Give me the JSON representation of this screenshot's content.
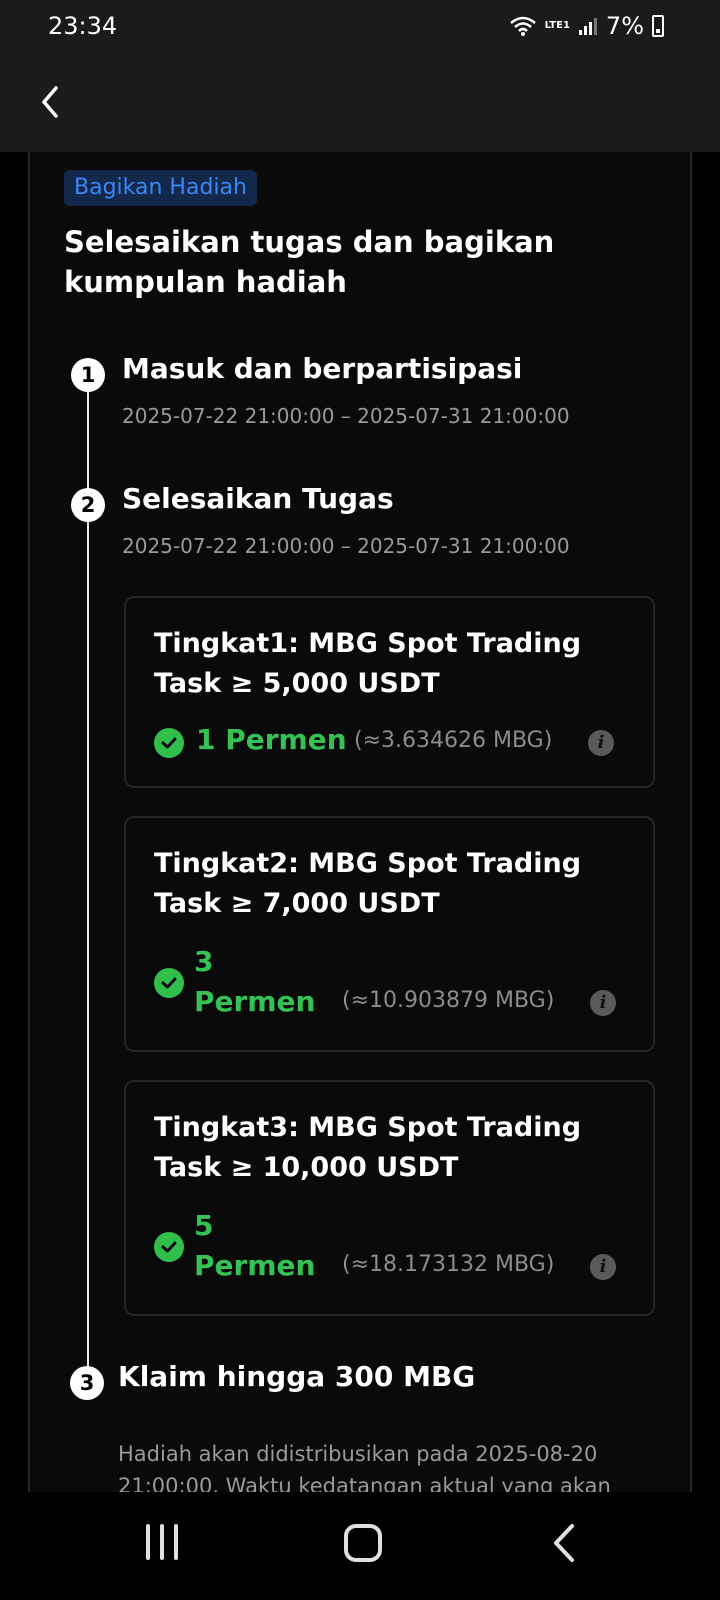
{
  "status_bar": {
    "time": "23:34",
    "network": "LTE1",
    "battery": "7%"
  },
  "header": {
    "back_icon": "chevron-left-icon"
  },
  "badge": "Bagikan Hadiah",
  "headline": "Selesaikan tugas dan bagikan kumpulan hadiah",
  "steps": [
    {
      "number": "1",
      "title": "Masuk dan berpartisipasi",
      "date": "2025-07-22 21:00:00 – 2025-07-31 21:00:00"
    },
    {
      "number": "2",
      "title": "Selesaikan Tugas",
      "date": "2025-07-22 21:00:00 – 2025-07-31 21:00:00",
      "tiers": [
        {
          "title": "Tingkat1: MBG Spot Trading Task ≥ 5,000 USDT",
          "amount": "1 Permen",
          "amount_num": "1",
          "amount_unit": "Permen",
          "approx": "(≈3.634626 MBG)"
        },
        {
          "title": "Tingkat2: MBG Spot Trading Task ≥ 7,000 USDT",
          "amount_num": "3",
          "amount_unit": "Permen",
          "approx": "(≈10.903879 MBG)"
        },
        {
          "title": "Tingkat3: MBG Spot Trading Task ≥ 10,000 USDT",
          "amount_num": "5",
          "amount_unit": "Permen",
          "approx": "(≈18.173132 MBG)"
        }
      ]
    },
    {
      "number": "3",
      "title": "Klaim hingga 300 MBG",
      "description": "Hadiah akan didistribusikan pada 2025-08-20 21:00:00. Waktu kedatangan aktual yang akan"
    }
  ],
  "colors": {
    "accent_blue": "#3b86f6",
    "success_green": "#35c255",
    "background": "#0a0a0a"
  },
  "icons": {
    "check": "check-circle-icon",
    "info": "info-icon"
  }
}
